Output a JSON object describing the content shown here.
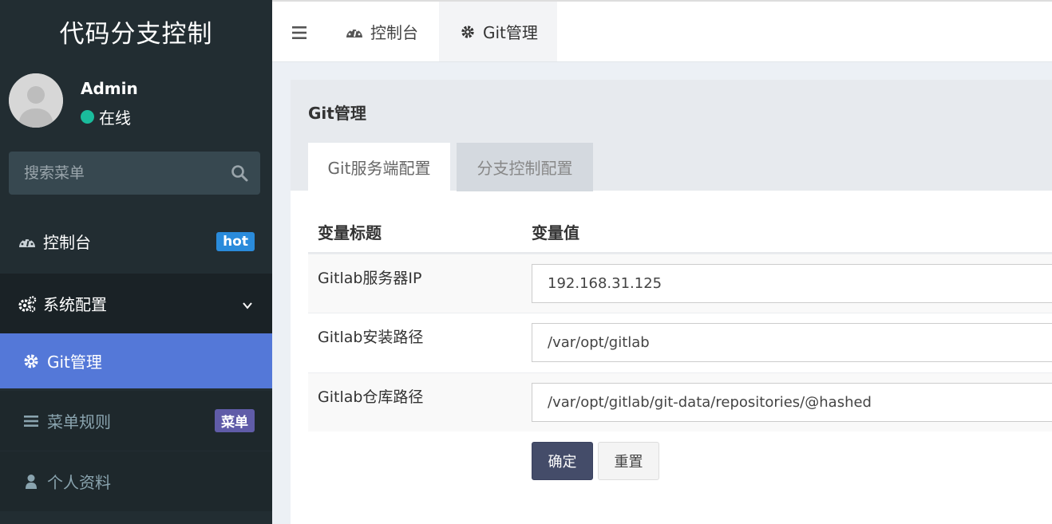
{
  "sidebar": {
    "logo": "代码分支控制",
    "user": {
      "name": "Admin",
      "status": "在线"
    },
    "search": {
      "placeholder": "搜索菜单"
    },
    "items": [
      {
        "label": "控制台",
        "badge": "hot",
        "icon": "dashboard-icon"
      },
      {
        "label": "系统配置",
        "icon": "gears-icon",
        "expand": "chevron-down-icon"
      },
      {
        "label": "Git管理",
        "icon": "gear-icon"
      },
      {
        "label": "菜单规则",
        "badge": "菜单",
        "icon": "list-icon"
      },
      {
        "label": "个人资料",
        "icon": "user-icon"
      }
    ]
  },
  "topbar": {
    "tabs": [
      {
        "label": "控制台",
        "icon": "dashboard-icon"
      },
      {
        "label": "Git管理",
        "icon": "gear-icon"
      }
    ]
  },
  "panel": {
    "title": "Git管理",
    "tabs": [
      {
        "label": "Git服务端配置"
      },
      {
        "label": "分支控制配置"
      }
    ],
    "table": {
      "headers": [
        "变量标题",
        "变量值"
      ],
      "rows": [
        {
          "label": "Gitlab服务器IP",
          "value": "192.168.31.125"
        },
        {
          "label": "Gitlab安装路径",
          "value": "/var/opt/gitlab"
        },
        {
          "label": "Gitlab仓库路径",
          "value": "/var/opt/gitlab/git-data/repositories/@hashed"
        }
      ]
    },
    "buttons": {
      "ok": "确定",
      "reset": "重置"
    }
  },
  "colors": {
    "sidebar_bg": "#222d32",
    "active_item": "#5478d8",
    "badge_hot": "#2a8bdb",
    "badge_menu": "#605ca8",
    "status_online": "#1abc9c",
    "primary_button": "#444c69"
  }
}
